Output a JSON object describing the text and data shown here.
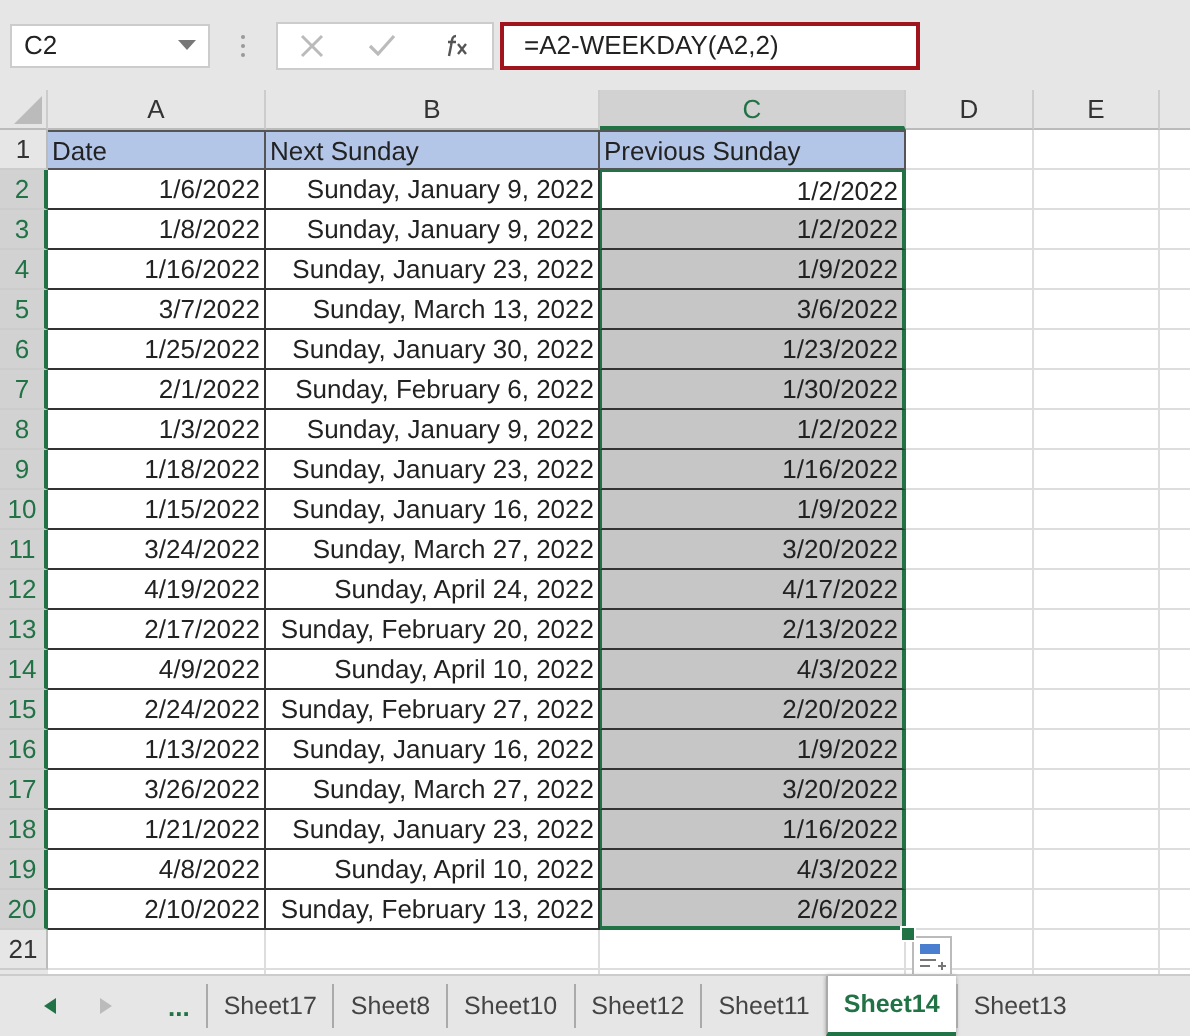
{
  "name_box": "C2",
  "formula": "=A2-WEEKDAY(A2,2)",
  "columns": [
    {
      "label": "A",
      "selected": false
    },
    {
      "label": "B",
      "selected": false
    },
    {
      "label": "C",
      "selected": true
    },
    {
      "label": "D",
      "selected": false
    },
    {
      "label": "E",
      "selected": false
    }
  ],
  "header_row": {
    "num": "1",
    "cells": [
      "Date",
      "Next Sunday",
      "Previous Sunday"
    ]
  },
  "rows": [
    {
      "num": "2",
      "date": "1/6/2022",
      "next": "Sunday, January 9, 2022",
      "prev": "1/2/2022",
      "selected": true,
      "active": true
    },
    {
      "num": "3",
      "date": "1/8/2022",
      "next": "Sunday, January 9, 2022",
      "prev": "1/2/2022",
      "selected": true,
      "active": false
    },
    {
      "num": "4",
      "date": "1/16/2022",
      "next": "Sunday, January 23, 2022",
      "prev": "1/9/2022",
      "selected": true,
      "active": false
    },
    {
      "num": "5",
      "date": "3/7/2022",
      "next": "Sunday, March 13, 2022",
      "prev": "3/6/2022",
      "selected": true,
      "active": false
    },
    {
      "num": "6",
      "date": "1/25/2022",
      "next": "Sunday, January 30, 2022",
      "prev": "1/23/2022",
      "selected": true,
      "active": false
    },
    {
      "num": "7",
      "date": "2/1/2022",
      "next": "Sunday, February 6, 2022",
      "prev": "1/30/2022",
      "selected": true,
      "active": false
    },
    {
      "num": "8",
      "date": "1/3/2022",
      "next": "Sunday, January 9, 2022",
      "prev": "1/2/2022",
      "selected": true,
      "active": false
    },
    {
      "num": "9",
      "date": "1/18/2022",
      "next": "Sunday, January 23, 2022",
      "prev": "1/16/2022",
      "selected": true,
      "active": false
    },
    {
      "num": "10",
      "date": "1/15/2022",
      "next": "Sunday, January 16, 2022",
      "prev": "1/9/2022",
      "selected": true,
      "active": false
    },
    {
      "num": "11",
      "date": "3/24/2022",
      "next": "Sunday, March 27, 2022",
      "prev": "3/20/2022",
      "selected": true,
      "active": false
    },
    {
      "num": "12",
      "date": "4/19/2022",
      "next": "Sunday, April 24, 2022",
      "prev": "4/17/2022",
      "selected": true,
      "active": false
    },
    {
      "num": "13",
      "date": "2/17/2022",
      "next": "Sunday, February 20, 2022",
      "prev": "2/13/2022",
      "selected": true,
      "active": false
    },
    {
      "num": "14",
      "date": "4/9/2022",
      "next": "Sunday, April 10, 2022",
      "prev": "4/3/2022",
      "selected": true,
      "active": false
    },
    {
      "num": "15",
      "date": "2/24/2022",
      "next": "Sunday, February 27, 2022",
      "prev": "2/20/2022",
      "selected": true,
      "active": false
    },
    {
      "num": "16",
      "date": "1/13/2022",
      "next": "Sunday, January 16, 2022",
      "prev": "1/9/2022",
      "selected": true,
      "active": false
    },
    {
      "num": "17",
      "date": "3/26/2022",
      "next": "Sunday, March 27, 2022",
      "prev": "3/20/2022",
      "selected": true,
      "active": false
    },
    {
      "num": "18",
      "date": "1/21/2022",
      "next": "Sunday, January 23, 2022",
      "prev": "1/16/2022",
      "selected": true,
      "active": false
    },
    {
      "num": "19",
      "date": "4/8/2022",
      "next": "Sunday, April 10, 2022",
      "prev": "4/3/2022",
      "selected": true,
      "active": false
    },
    {
      "num": "20",
      "date": "2/10/2022",
      "next": "Sunday, February 13, 2022",
      "prev": "2/6/2022",
      "selected": true,
      "active": false
    }
  ],
  "empty_rows": [
    "21"
  ],
  "tab_more": "...",
  "sheet_tabs": [
    {
      "label": "Sheet17",
      "selected": false
    },
    {
      "label": "Sheet8",
      "selected": false
    },
    {
      "label": "Sheet10",
      "selected": false
    },
    {
      "label": "Sheet12",
      "selected": false
    },
    {
      "label": "Sheet11",
      "selected": false
    },
    {
      "label": "Sheet14",
      "selected": true
    },
    {
      "label": "Sheet13",
      "selected": false
    }
  ]
}
